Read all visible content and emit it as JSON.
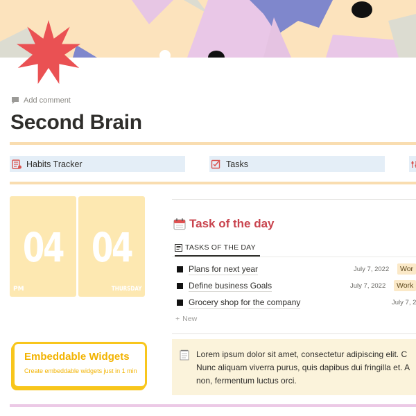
{
  "page": {
    "add_comment": "Add comment",
    "title": "Second Brain"
  },
  "nav_links": [
    {
      "label": "Habits Tracker",
      "icon": "habits-calendar-icon"
    },
    {
      "label": "Tasks",
      "icon": "tasks-checklist-icon"
    }
  ],
  "clock": {
    "hour": "04",
    "minute": "04",
    "meridiem": "PM",
    "weekday": "THURSDAY"
  },
  "widget": {
    "title": "Embeddable Widgets",
    "subtitle": "Create embeddable widgets just in 1 min"
  },
  "task_section": {
    "title": "Task of the day",
    "view_tab": "TASKS OF THE DAY",
    "new_label": "New",
    "tasks": [
      {
        "name": "Plans for next year",
        "date": "July 7, 2022",
        "tag": "Wor"
      },
      {
        "name": "Define business Goals",
        "date": "July 7, 2022",
        "tag": "Work"
      },
      {
        "name": "Grocery shop for the company",
        "date": "July 7, 2",
        "tag": ""
      }
    ]
  },
  "callout": {
    "lines": [
      "Lorem ipsum dolor sit amet, consectetur adipiscing elit. C",
      "Nunc aliquam viverra purus, quis dapibus dui fringilla et. A",
      "non, fermentum luctus orci."
    ]
  },
  "colors": {
    "cover_bg": "#fce3bd",
    "accent_red": "#c9444e",
    "clock_bg": "#fde8b1",
    "widget_yellow": "#f8c61c",
    "nav_bg": "#e4eef7",
    "callout_bg": "#fbf3db"
  }
}
